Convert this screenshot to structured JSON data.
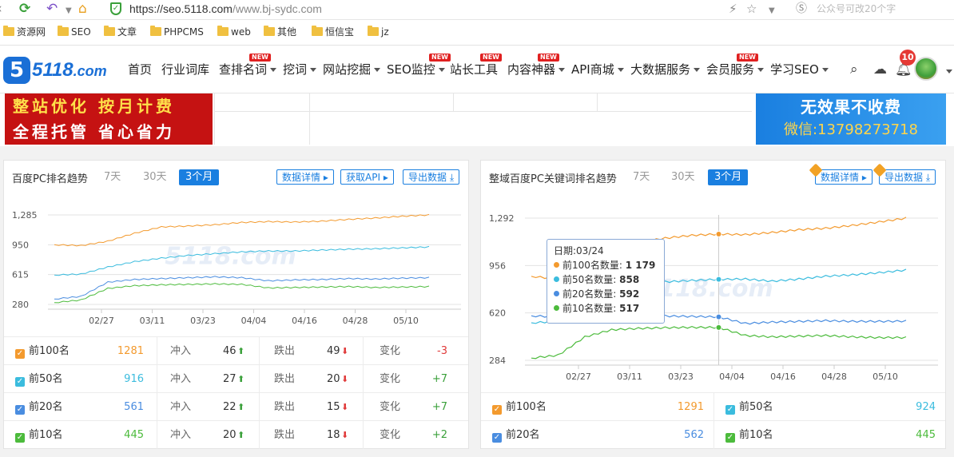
{
  "browser": {
    "url_host": "https://seo.5118.com",
    "url_path": "/www.bj-sydc.com",
    "search_hint": "公众号可改20个字"
  },
  "bookmarks": [
    "资源网",
    "SEO",
    "文章",
    "PHPCMS",
    "web",
    "其他",
    "恒信宝",
    "jz"
  ],
  "site": {
    "logo_text": "5118",
    "logo_suffix": ".com",
    "new_tag": "NEW",
    "nav": [
      {
        "label": "首页",
        "caret": false,
        "new": false
      },
      {
        "label": "行业词库",
        "caret": false,
        "new": false
      },
      {
        "label": "查排名词",
        "caret": true,
        "new": true
      },
      {
        "label": "挖词",
        "caret": true,
        "new": false
      },
      {
        "label": "网站挖掘",
        "caret": true,
        "new": false
      },
      {
        "label": "SEO监控",
        "caret": true,
        "new": true
      },
      {
        "label": "站长工具",
        "caret": false,
        "new": true
      },
      {
        "label": "内容神器",
        "caret": true,
        "new": true
      },
      {
        "label": "API商城",
        "caret": true,
        "new": false
      },
      {
        "label": "大数据服务",
        "caret": true,
        "new": false
      },
      {
        "label": "会员服务",
        "caret": true,
        "new": true
      },
      {
        "label": "学习SEO",
        "caret": true,
        "new": false
      }
    ],
    "notification_count": "10"
  },
  "banner": {
    "left_line1": "整站优化 按月计费",
    "left_line2": "全程托管 省心省力",
    "right_line1": "无效果不收费",
    "right_line2": "微信:13798273718"
  },
  "left_panel": {
    "title": "百度PC排名趋势",
    "ranges": [
      "7天",
      "30天",
      "3个月"
    ],
    "buttons": {
      "detail": "数据详情",
      "api": "获取API",
      "export": "导出数据"
    },
    "labels": {
      "rush_in": "冲入",
      "drop_out": "跌出",
      "change": "变化"
    },
    "rows": [
      {
        "name": "前100名",
        "value": "1281",
        "rush": "46",
        "drop": "49",
        "change": "-3",
        "color": "#f39a2e"
      },
      {
        "name": "前50名",
        "value": "916",
        "rush": "27",
        "drop": "20",
        "change": "+7",
        "color": "#3bbcde"
      },
      {
        "name": "前20名",
        "value": "561",
        "rush": "22",
        "drop": "15",
        "change": "+7",
        "color": "#4a8de0"
      },
      {
        "name": "前10名",
        "value": "445",
        "rush": "20",
        "drop": "18",
        "change": "+2",
        "color": "#4cbb3c"
      }
    ]
  },
  "right_panel": {
    "title": "整域百度PC关键词排名趋势",
    "ranges": [
      "7天",
      "30天",
      "3个月"
    ],
    "buttons": {
      "detail": "数据详情",
      "export": "导出数据"
    },
    "legend": [
      {
        "name": "前100名",
        "value": "1291",
        "color": "#f39a2e"
      },
      {
        "name": "前50名",
        "value": "924",
        "color": "#3bbcde"
      },
      {
        "name": "前20名",
        "value": "562",
        "color": "#4a8de0"
      },
      {
        "name": "前10名",
        "value": "445",
        "color": "#4cbb3c"
      }
    ],
    "tooltip": {
      "date": "日期:03/24",
      "items": [
        {
          "label": "前100名数量:",
          "value": "1 179",
          "color": "#f39a2e"
        },
        {
          "label": "前50名数量:",
          "value": "858",
          "color": "#3bbcde"
        },
        {
          "label": "前20名数量:",
          "value": "592",
          "color": "#4a8de0"
        },
        {
          "label": "前10名数量:",
          "value": "517",
          "color": "#4cbb3c"
        }
      ]
    }
  },
  "chart_data": [
    {
      "type": "line",
      "title": "百度PC排名趋势",
      "xticks": [
        "02/27",
        "03/11",
        "03/23",
        "04/04",
        "04/16",
        "04/28",
        "05/10"
      ],
      "yticks": [
        280,
        615,
        950,
        1285
      ],
      "ylim": [
        280,
        1285
      ],
      "grid": true,
      "series": [
        {
          "name": "前100名",
          "color": "#f39a2e",
          "values": [
            950,
            940,
            990,
            1080,
            1150,
            1160,
            1175,
            1200,
            1210,
            1205,
            1215,
            1235,
            1250,
            1270,
            1285
          ]
        },
        {
          "name": "前50名",
          "color": "#3bbcde",
          "values": [
            610,
            620,
            700,
            760,
            800,
            830,
            850,
            870,
            880,
            880,
            890,
            900,
            905,
            915,
            925
          ]
        },
        {
          "name": "前20名",
          "color": "#4a8de0",
          "values": [
            340,
            370,
            530,
            560,
            570,
            580,
            590,
            580,
            545,
            555,
            560,
            570,
            565,
            575,
            580
          ]
        },
        {
          "name": "前10名",
          "color": "#4cbb3c",
          "values": [
            300,
            330,
            460,
            490,
            500,
            505,
            510,
            505,
            465,
            470,
            475,
            480,
            470,
            475,
            480
          ]
        }
      ]
    },
    {
      "type": "line",
      "title": "整域百度PC关键词排名趋势",
      "xticks": [
        "02/27",
        "03/11",
        "03/23",
        "04/04",
        "04/16",
        "04/28",
        "05/10"
      ],
      "yticks": [
        284,
        620,
        956,
        1292
      ],
      "ylim": [
        284,
        1292
      ],
      "grid": true,
      "series": [
        {
          "name": "前100名",
          "color": "#f39a2e",
          "values": [
            880,
            860,
            930,
            1050,
            1120,
            1150,
            1170,
            1179,
            1175,
            1190,
            1210,
            1220,
            1240,
            1265,
            1292
          ]
        },
        {
          "name": "前50名",
          "color": "#3bbcde",
          "values": [
            550,
            560,
            640,
            760,
            820,
            840,
            850,
            858,
            860,
            845,
            860,
            880,
            890,
            905,
            924
          ]
        },
        {
          "name": "前20名",
          "color": "#4a8de0",
          "values": [
            600,
            590,
            610,
            600,
            600,
            598,
            595,
            592,
            545,
            555,
            560,
            565,
            560,
            560,
            562
          ]
        },
        {
          "name": "前10名",
          "color": "#4cbb3c",
          "values": [
            300,
            320,
            450,
            500,
            510,
            515,
            518,
            517,
            460,
            450,
            455,
            460,
            450,
            445,
            445
          ]
        }
      ]
    }
  ]
}
